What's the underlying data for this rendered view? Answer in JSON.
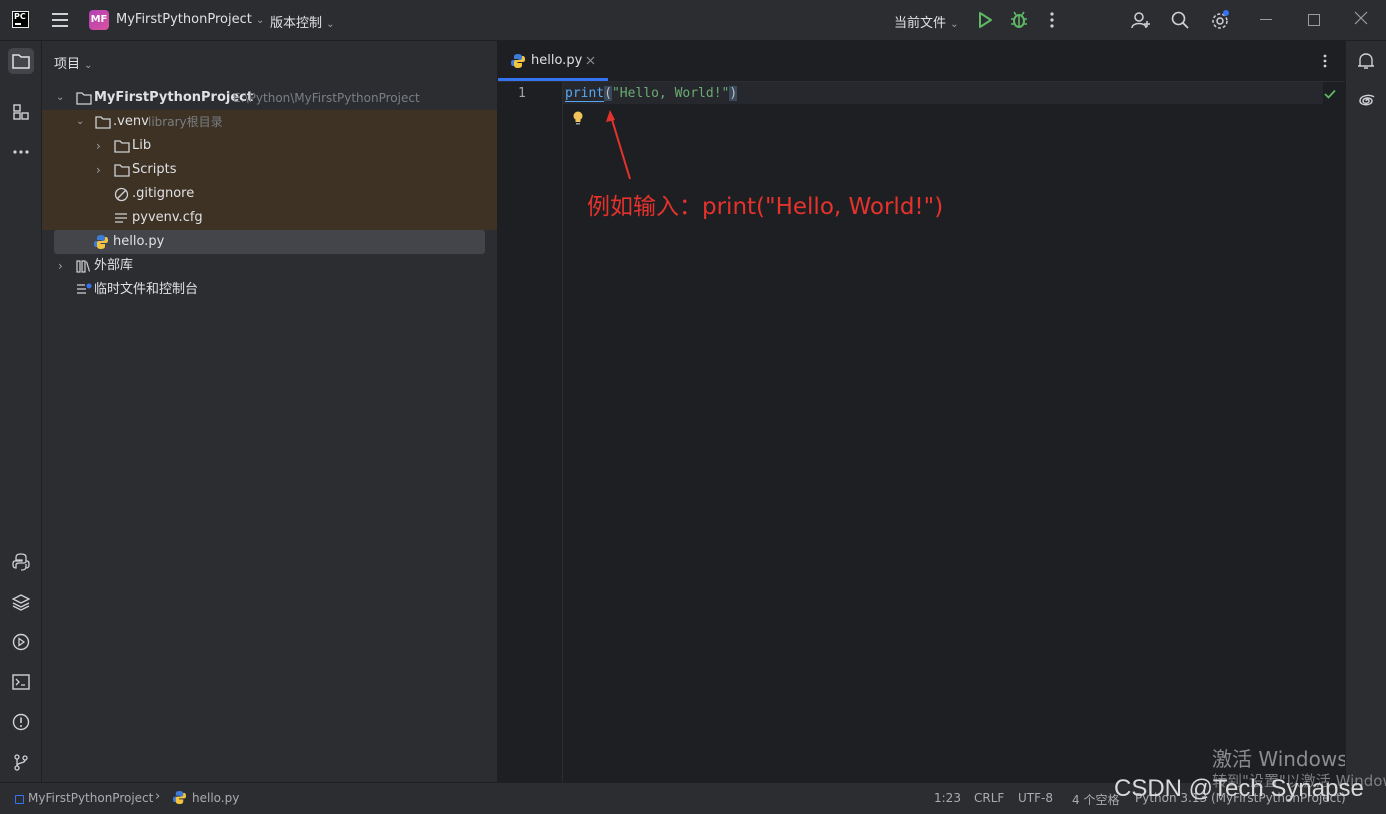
{
  "titlebar": {
    "ide_logo_text": "PC",
    "project_badge": "MF",
    "project_name": "MyFirstPythonProject",
    "vcs_menu": "版本控制",
    "run_config": "当前文件"
  },
  "project_panel": {
    "title": "项目",
    "tree": {
      "root_name": "MyFirstPythonProject",
      "root_path": "E:\\Python\\MyFirstPythonProject",
      "venv_name": ".venv",
      "venv_note": "library根目录",
      "lib": "Lib",
      "scripts": "Scripts",
      "gitignore": ".gitignore",
      "pyvenv": "pyvenv.cfg",
      "hello": "hello.py",
      "external_libs": "外部库",
      "scratches": "临时文件和控制台"
    }
  },
  "editor": {
    "tab_label": "hello.py",
    "line_number": "1",
    "code": {
      "func": "print",
      "open_paren": "(",
      "string": "\"Hello, World!\"",
      "close_paren": ")"
    },
    "annotation": "例如输入：print(\"Hello, World!\")",
    "annotation_color": "#e5322d"
  },
  "statusbar": {
    "breadcrumb_project": "MyFirstPythonProject",
    "breadcrumb_file": "hello.py",
    "position": "1:23",
    "line_sep": "CRLF",
    "encoding": "UTF-8",
    "indent": "4 个空格",
    "interpreter": "Python 3.13 (MyFirstPythonProject)"
  },
  "watermark": {
    "activate_title": "激活 Windows",
    "activate_sub": "转到\"设置\"以激活 Windows。",
    "csdn": "CSDN @Tech Synapse"
  },
  "colors": {
    "accent": "#3574f0",
    "run_green": "#5fb865",
    "keyword_blue": "#56a8f5",
    "string_green": "#6aab73"
  }
}
